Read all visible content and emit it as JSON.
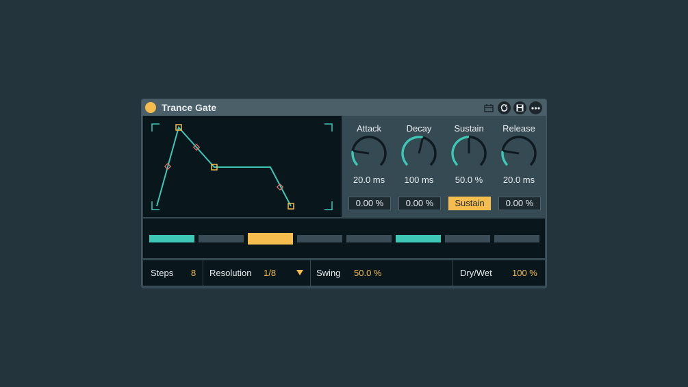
{
  "device": {
    "title": "Trance Gate",
    "colors": {
      "accent": "#f5bd4e",
      "teal": "#3fc7b5",
      "panel": "#364a53",
      "dark": "#09171d"
    },
    "header_icons": [
      "calendar-icon",
      "sync-icon",
      "save-icon",
      "more-icon"
    ]
  },
  "knobs": [
    {
      "label": "Attack",
      "value": "20.0 ms",
      "box": "0.00 %",
      "level": 0.2
    },
    {
      "label": "Decay",
      "value": "100 ms",
      "box": "0.00 %",
      "level": 0.55
    },
    {
      "label": "Sustain",
      "value": "50.0 %",
      "box": "Sustain",
      "level": 0.5
    },
    {
      "label": "Release",
      "value": "20.0 ms",
      "box": "0.00 %",
      "level": 0.2
    }
  ],
  "steps": {
    "states": [
      "on",
      "off",
      "accent",
      "off",
      "off",
      "on",
      "off",
      "off"
    ]
  },
  "controls": {
    "steps_label": "Steps",
    "steps_value": "8",
    "resolution_label": "Resolution",
    "resolution_value": "1/8",
    "swing_label": "Swing",
    "swing_value": "50.0 %",
    "drywet_label": "Dry/Wet",
    "drywet_value": "100 %"
  }
}
